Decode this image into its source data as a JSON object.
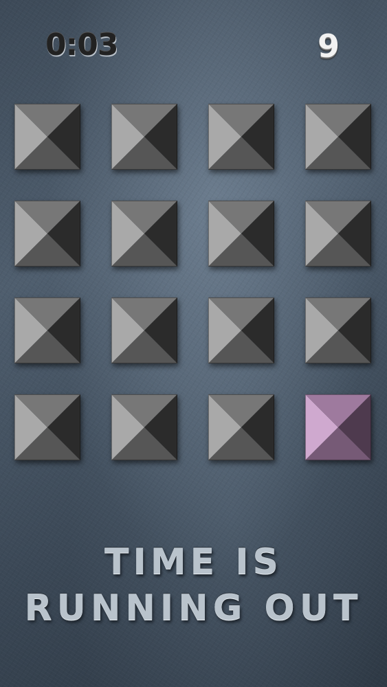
{
  "hud": {
    "timer": "0:03",
    "score": "9"
  },
  "grid": {
    "rows": 4,
    "columns": 4,
    "tiles": [
      {
        "id": 1,
        "state": "normal"
      },
      {
        "id": 2,
        "state": "normal"
      },
      {
        "id": 3,
        "state": "normal"
      },
      {
        "id": 4,
        "state": "normal"
      },
      {
        "id": 5,
        "state": "normal"
      },
      {
        "id": 6,
        "state": "normal"
      },
      {
        "id": 7,
        "state": "normal"
      },
      {
        "id": 8,
        "state": "normal"
      },
      {
        "id": 9,
        "state": "normal"
      },
      {
        "id": 10,
        "state": "normal"
      },
      {
        "id": 11,
        "state": "normal"
      },
      {
        "id": 12,
        "state": "normal"
      },
      {
        "id": 13,
        "state": "normal"
      },
      {
        "id": 14,
        "state": "normal"
      },
      {
        "id": 15,
        "state": "normal"
      },
      {
        "id": 16,
        "state": "highlighted"
      }
    ]
  },
  "colors": {
    "tile_normal": [
      "#a9a9a9",
      "#777777",
      "#2b2b2b",
      "#565656"
    ],
    "tile_highlighted": [
      "#cfa9cf",
      "#9e7a9e",
      "#4e3a4e",
      "#765a76"
    ]
  },
  "message": {
    "line1": "TIME IS",
    "line2": "RUNNING OUT"
  }
}
